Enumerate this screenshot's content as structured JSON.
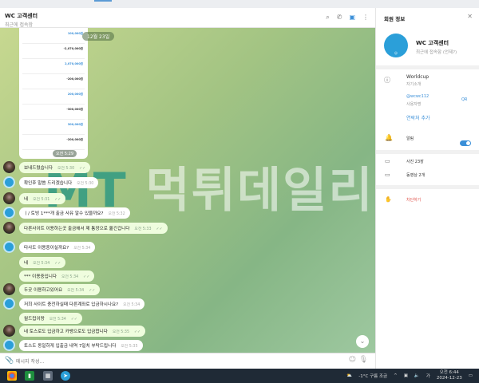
{
  "header": {
    "title": "WC 고객센터",
    "subtitle": "최근에 접속함"
  },
  "chat": {
    "date_badge": "12월 23일",
    "screenshot_time": "오전 5:29",
    "screenshot_amounts": [
      "100,000원",
      "-2,070,000원",
      "2,070,000원",
      "-200,000원",
      "200,000원",
      "-300,000원",
      "300,000원",
      "-200,000원"
    ],
    "messages": [
      {
        "dir": "out",
        "text": "보내드렸습니다",
        "time": "오전 5:30"
      },
      {
        "dir": "in",
        "text": "확인후 말씀 드리겠습니다",
        "time": "오전 5:30"
      },
      {
        "dir": "out",
        "text": "네",
        "time": "오전 5:31"
      },
      {
        "dir": "in",
        "text": "ㅣ/ 토빙 1***개 출금 사유 알수 있을까요?",
        "time": "오전 5:32"
      },
      {
        "dir": "out",
        "text": "다른사이트 이용하는곳 출금해서 제 통장으로 옮긴겁니다",
        "time": "오전 5:33"
      },
      {
        "dir": "in",
        "text": "타사도 이용중이실까요?",
        "time": "오전 5:34"
      },
      {
        "dir": "out",
        "text": "네",
        "time": "오전 5:34"
      },
      {
        "dir": "out",
        "text": "*** 이용중입니다",
        "time": "오전 5:34"
      },
      {
        "dir": "out",
        "text": "두곳 이용하고있어요",
        "time": "오전 5:34"
      },
      {
        "dir": "in",
        "text": "저희 사이트 충전하실때 다른계좌로 입금하시나요?",
        "time": "오전 5:34"
      },
      {
        "dir": "out",
        "text": "월드컵이랑",
        "time": "오전 5:34"
      },
      {
        "dir": "out",
        "text": "네 토스로도 입금하고 카뱅으로도 입금합니다",
        "time": "오전 5:35"
      },
      {
        "dir": "in",
        "text": "토스도 동일하게 입출금 내역 7일치 부탁드립니다",
        "time": "오전 5:35"
      }
    ],
    "watermark_mt": "MT",
    "watermark_text": "먹튀데일리"
  },
  "input": {
    "placeholder": "메시지 작성..."
  },
  "panel": {
    "title": "회원 정보",
    "name": "WC 고객센터",
    "status": "최근에 접속함",
    "status_extra": "(언제?)",
    "bio": "Worldcup",
    "bio_label": "자기소개",
    "username": "@wcwc112",
    "username_label": "사용자명",
    "qr": "QR",
    "add_contact": "연락처 추가",
    "notifications": "알림",
    "photos": "사진 23장",
    "videos": "동영상 2개",
    "block": "차단하기"
  },
  "taskbar": {
    "weather": "-1°C 구름 조금",
    "time": "오전 6:44",
    "date": "2024-12-23",
    "ime": "가"
  }
}
